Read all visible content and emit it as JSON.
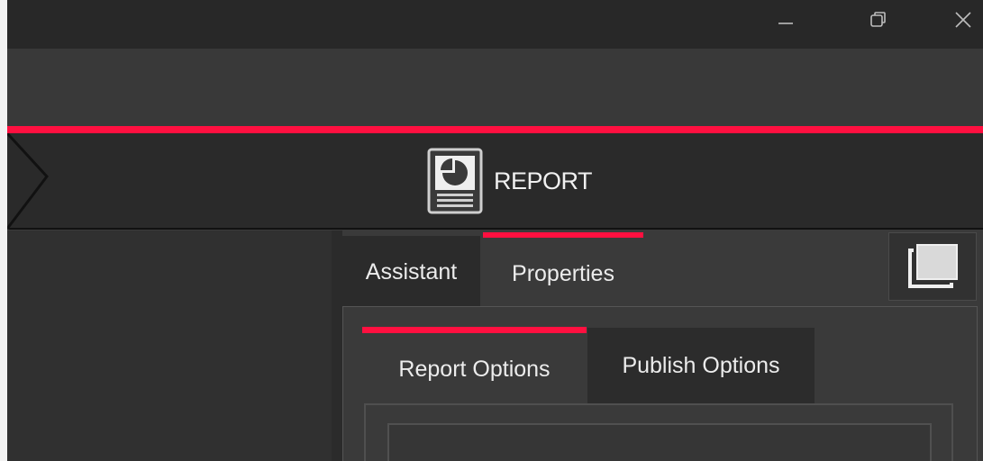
{
  "window": {
    "controls": {
      "minimize_icon": "minimize-icon",
      "restore_icon": "restore-icon",
      "close_icon": "close-icon"
    }
  },
  "banner": {
    "title": "REPORT",
    "icon": "report-document-icon"
  },
  "tabs": [
    {
      "label": "Assistant"
    },
    {
      "label": "Properties"
    }
  ],
  "dock_button": {
    "icon": "window-dock-icon"
  },
  "subtabs": [
    {
      "label": "Report Options"
    },
    {
      "label": "Publish Options"
    }
  ],
  "colors": {
    "accent": "#ff1040",
    "title_bar": "#282828",
    "panel": "#3a3a3a",
    "dark_tab": "#2b2b2b"
  }
}
